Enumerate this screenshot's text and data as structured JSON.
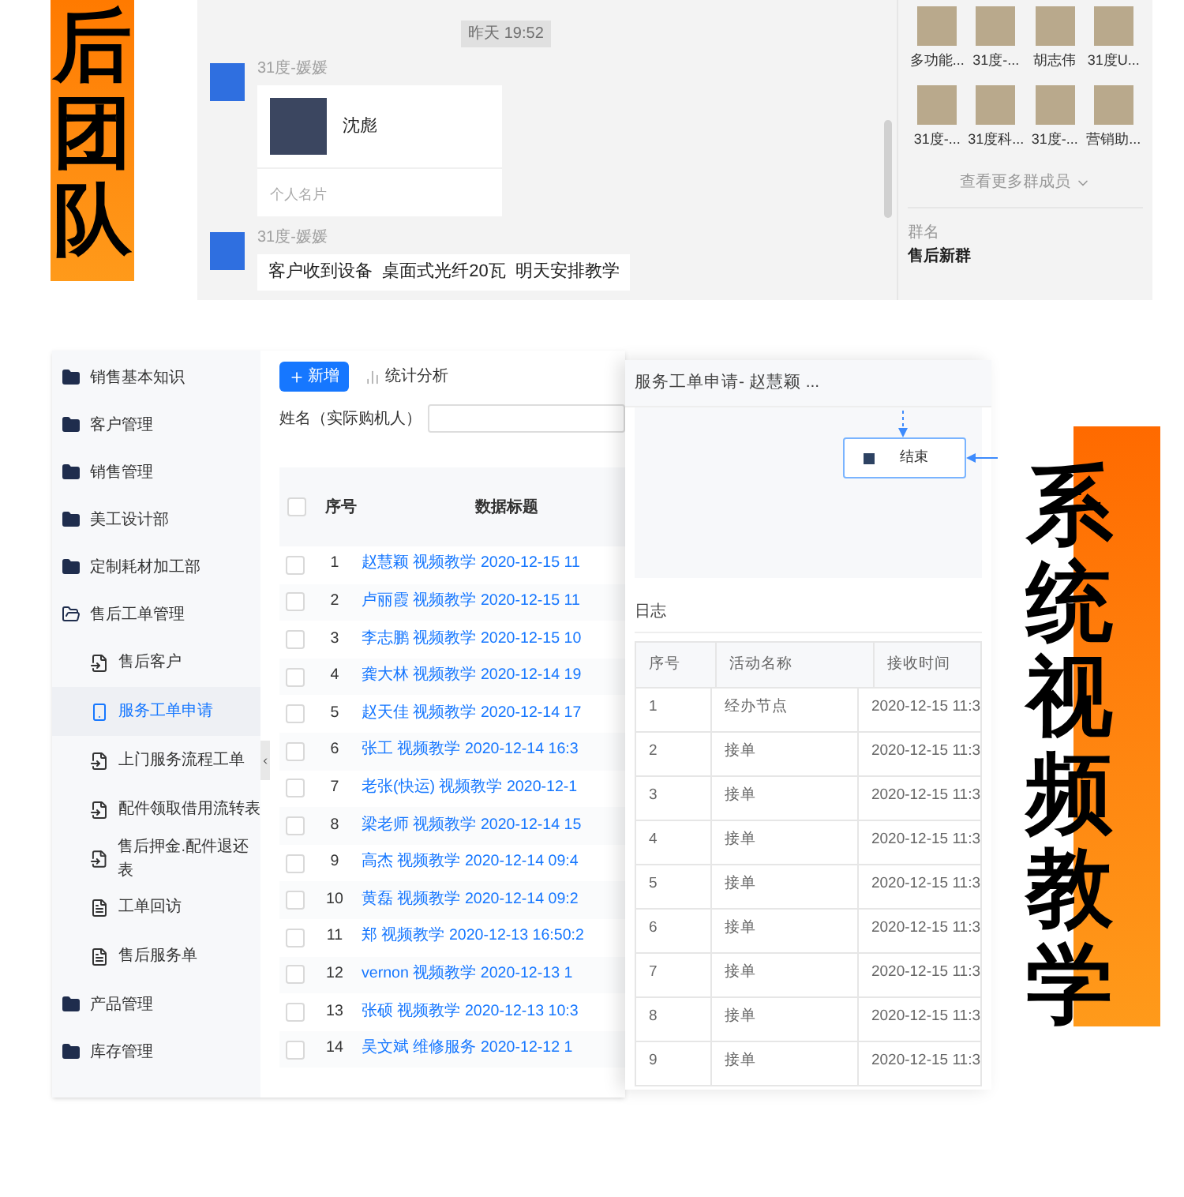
{
  "top_banner": {
    "text": "后团队"
  },
  "chat": {
    "timestamp": "昨天 19:52",
    "messages": [
      {
        "kind": "card",
        "sender": "31度-媛媛",
        "name": "沈彪",
        "footer": "个人名片"
      },
      {
        "kind": "text",
        "sender": "31度-媛媛",
        "text": "客户收到设备  桌面式光纤20瓦  明天安排教学"
      }
    ],
    "members": [
      {
        "name": "多功能..."
      },
      {
        "name": "31度-..."
      },
      {
        "name": "胡志伟"
      },
      {
        "name": "31度U..."
      },
      {
        "name": "31度-..."
      },
      {
        "name": "31度科..."
      },
      {
        "name": "31度-..."
      },
      {
        "name": "营销助..."
      }
    ],
    "more_link": "查看更多群成员",
    "group_name_label": "群名",
    "group_name": "售后新群"
  },
  "admin": {
    "sidebar": {
      "items": [
        {
          "label": "销售基本知识",
          "expanded": false
        },
        {
          "label": "客户管理",
          "expanded": false
        },
        {
          "label": "销售管理",
          "expanded": false
        },
        {
          "label": "美工设计部",
          "expanded": false
        },
        {
          "label": "定制耗材加工部",
          "expanded": false
        },
        {
          "label": "售后工单管理",
          "expanded": true,
          "children": [
            {
              "label": "售后客户",
              "kind": "form",
              "selected": false
            },
            {
              "label": "服务工单申请",
              "kind": "mobile",
              "selected": true
            },
            {
              "label": "上门服务流程工单",
              "kind": "form",
              "selected": false
            },
            {
              "label": "配件领取借用流转表",
              "kind": "form",
              "selected": false
            },
            {
              "label": "售后押金.配件退还表",
              "kind": "form",
              "selected": false
            },
            {
              "label": "工单回访",
              "kind": "doc",
              "selected": false
            },
            {
              "label": "售后服务单",
              "kind": "doc",
              "selected": false
            }
          ]
        },
        {
          "label": "产品管理",
          "expanded": false
        },
        {
          "label": "库存管理",
          "expanded": false
        }
      ]
    },
    "toolbar": {
      "add_button": "新增",
      "stats_link": "统计分析"
    },
    "filter": {
      "label": "姓名（实际购机人）"
    },
    "table": {
      "header_checked": false,
      "columns": [
        "序号",
        "数据标题"
      ],
      "rows": [
        {
          "no": "1",
          "title": "赵慧颖 视频教学 2020-12-15 11",
          "checked": false
        },
        {
          "no": "2",
          "title": "卢丽霞 视频教学 2020-12-15 11",
          "checked": false
        },
        {
          "no": "3",
          "title": "李志鹏 视频教学 2020-12-15 10",
          "checked": false
        },
        {
          "no": "4",
          "title": "龚大林 视频教学 2020-12-14 19",
          "checked": false
        },
        {
          "no": "5",
          "title": "赵天佳 视频教学 2020-12-14 17",
          "checked": false
        },
        {
          "no": "6",
          "title": "张工 视频教学 2020-12-14 16:3",
          "checked": false
        },
        {
          "no": "7",
          "title": "老张(快运) 视频教学 2020-12-1",
          "checked": false
        },
        {
          "no": "8",
          "title": "梁老师 视频教学 2020-12-14 15",
          "checked": false
        },
        {
          "no": "9",
          "title": "高杰 视频教学 2020-12-14 09:4",
          "checked": false
        },
        {
          "no": "10",
          "title": "黄磊 视频教学 2020-12-14 09:2",
          "checked": false
        },
        {
          "no": "11",
          "title": "郑 视频教学 2020-12-13 16:50:2",
          "checked": false
        },
        {
          "no": "12",
          "title": "vernon 视频教学 2020-12-13 1",
          "checked": false
        },
        {
          "no": "13",
          "title": "张硕 视频教学 2020-12-13 10:3",
          "checked": false
        },
        {
          "no": "14",
          "title": "吴文斌 维修服务 2020-12-12 1",
          "checked": false
        }
      ]
    }
  },
  "detail_panel": {
    "title": "服务工单申请- 赵慧颖 ...",
    "flow_node": "结束",
    "log": {
      "title": "日志",
      "columns": [
        "序号",
        "活动名称",
        "接收时间"
      ],
      "rows": [
        {
          "no": "1",
          "activity": "经办节点",
          "time": "2020-12-15 11:3"
        },
        {
          "no": "2",
          "activity": "接单",
          "time": "2020-12-15 11:3"
        },
        {
          "no": "3",
          "activity": "接单",
          "time": "2020-12-15 11:3"
        },
        {
          "no": "4",
          "activity": "接单",
          "time": "2020-12-15 11:3"
        },
        {
          "no": "5",
          "activity": "接单",
          "time": "2020-12-15 11:3"
        },
        {
          "no": "6",
          "activity": "接单",
          "time": "2020-12-15 11:3"
        },
        {
          "no": "7",
          "activity": "接单",
          "time": "2020-12-15 11:3"
        },
        {
          "no": "8",
          "activity": "接单",
          "time": "2020-12-15 11:3"
        },
        {
          "no": "9",
          "activity": "接单",
          "time": "2020-12-15 11:3"
        }
      ]
    }
  },
  "side_banner": {
    "text": "系统视频教学"
  }
}
